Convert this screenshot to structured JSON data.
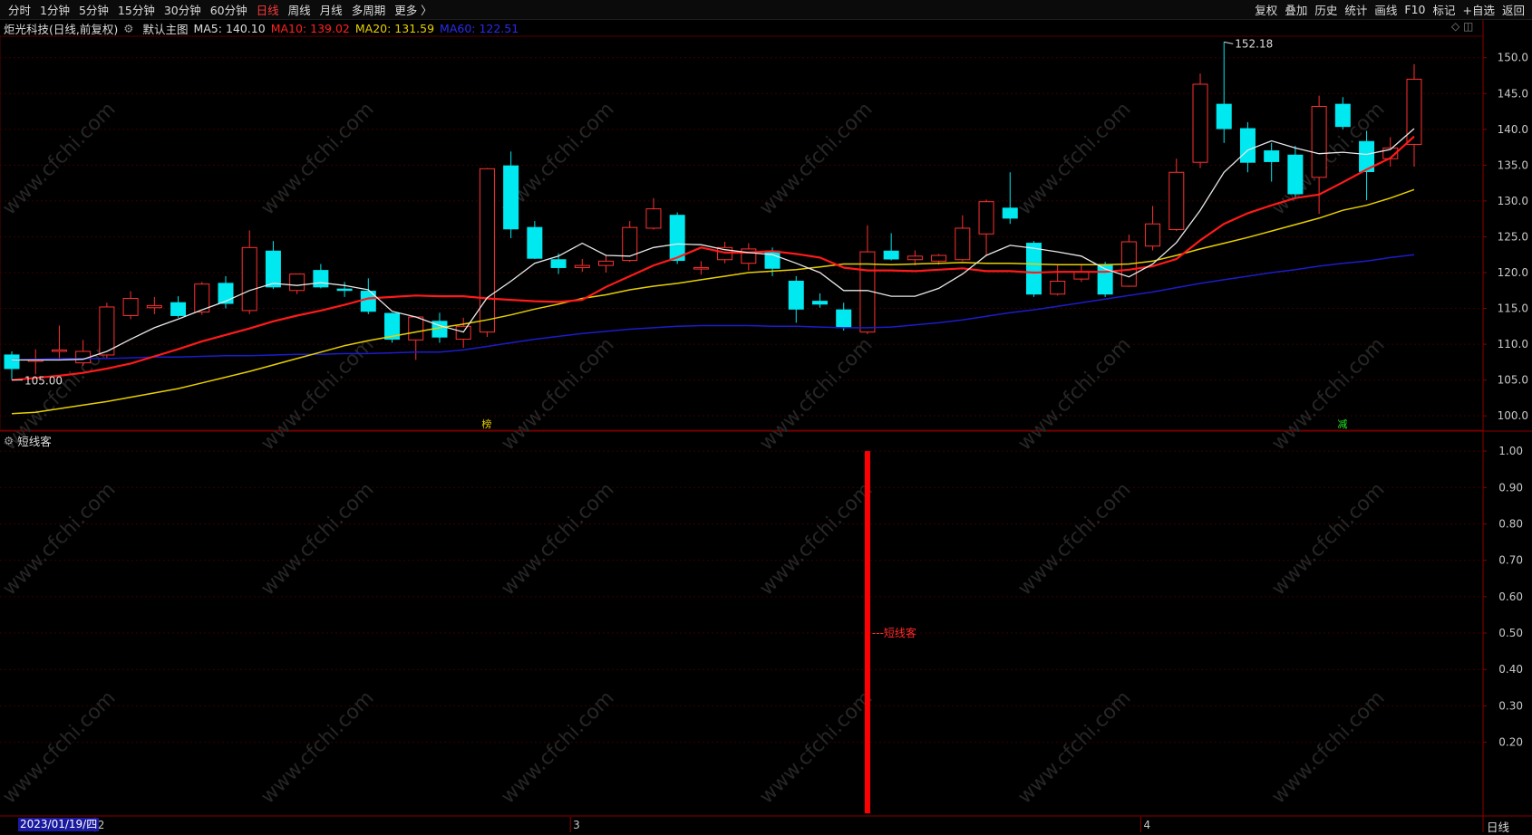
{
  "topbar": {
    "tabs": [
      "分时",
      "1分钟",
      "5分钟",
      "15分钟",
      "30分钟",
      "60分钟",
      "日线",
      "周线",
      "月线",
      "多周期",
      "更多 〉"
    ],
    "active_tab": "日线",
    "tools": [
      "复权",
      "叠加",
      "历史",
      "统计",
      "画线",
      "F10",
      "标记",
      "+自选",
      "返回"
    ]
  },
  "header": {
    "stock": "炬光科技(日线,前复权)",
    "main_chart": "默认主图",
    "ma5": "MA5: 140.10",
    "ma10": "MA10: 139.02",
    "ma20": "MA20: 131.59",
    "ma60": "MA60: 122.51"
  },
  "sub_panel": {
    "title": "短线客",
    "signal_label": "短线客"
  },
  "footer": {
    "date": "2023/01/19/四",
    "month_labels": [
      "2",
      "3",
      "4"
    ],
    "period": "日线"
  },
  "annotations": {
    "high": "152.18",
    "low": "105.00",
    "mark1": "榜",
    "mark2": "减"
  },
  "watermark": "www.cfchi.com",
  "chart_data": [
    {
      "type": "candlestick",
      "ylim": [
        98,
        153
      ],
      "y_ticks": [
        "150.0",
        "145.0",
        "140.0",
        "135.0",
        "130.0",
        "125.0",
        "120.0",
        "115.0",
        "110.0",
        "105.0",
        "100.0"
      ],
      "candles": [
        [
          108.5,
          106.6,
          109.0,
          105.0
        ],
        [
          107.6,
          107.8,
          109.3,
          105.8
        ],
        [
          109.0,
          109.2,
          112.6,
          107.8
        ],
        [
          107.4,
          109.0,
          110.6,
          107.0
        ],
        [
          108.5,
          115.2,
          115.8,
          108.0
        ],
        [
          114.0,
          116.4,
          117.4,
          113.5
        ],
        [
          115.1,
          115.4,
          116.6,
          114.2
        ],
        [
          115.8,
          114.0,
          116.7,
          113.7
        ],
        [
          114.5,
          118.4,
          118.7,
          114.1
        ],
        [
          118.5,
          115.7,
          119.5,
          115.0
        ],
        [
          114.7,
          123.5,
          125.9,
          114.2
        ],
        [
          123.0,
          118.0,
          124.4,
          117.7
        ],
        [
          117.5,
          119.8,
          119.6,
          117.0
        ],
        [
          120.3,
          118.0,
          121.2,
          117.8
        ],
        [
          117.7,
          117.6,
          118.7,
          116.6
        ],
        [
          117.4,
          114.6,
          119.2,
          114.2
        ],
        [
          114.3,
          110.7,
          114.4,
          110.2
        ],
        [
          110.6,
          113.8,
          113.9,
          107.8
        ],
        [
          113.2,
          111.0,
          114.4,
          110.2
        ],
        [
          110.7,
          112.5,
          113.7,
          109.5
        ],
        [
          111.7,
          134.5,
          134.6,
          111.0
        ],
        [
          134.9,
          126.1,
          136.9,
          124.8
        ],
        [
          126.3,
          122.0,
          127.2,
          121.9
        ],
        [
          121.8,
          120.7,
          122.7,
          119.8
        ],
        [
          120.7,
          121.0,
          121.9,
          120.1
        ],
        [
          121.0,
          121.6,
          122.5,
          120.0
        ],
        [
          121.7,
          126.3,
          127.2,
          121.5
        ],
        [
          126.2,
          128.9,
          130.4,
          126.0
        ],
        [
          128.0,
          121.7,
          128.4,
          121.2
        ],
        [
          120.5,
          120.7,
          121.6,
          119.7
        ],
        [
          121.8,
          123.5,
          124.3,
          121.3
        ],
        [
          121.3,
          123.3,
          124.1,
          120.3
        ],
        [
          123.0,
          120.6,
          123.5,
          119.5
        ],
        [
          118.8,
          114.9,
          119.5,
          113.0
        ],
        [
          116.0,
          115.6,
          117.1,
          115.1
        ],
        [
          114.8,
          112.3,
          115.8,
          111.9
        ],
        [
          111.7,
          122.9,
          126.6,
          111.4
        ],
        [
          123.0,
          121.9,
          125.5,
          121.7
        ],
        [
          121.8,
          122.3,
          123.1,
          121.0
        ],
        [
          121.6,
          122.4,
          122.6,
          121.1
        ],
        [
          121.8,
          126.2,
          128.0,
          121.6
        ],
        [
          125.4,
          129.9,
          130.2,
          122.3
        ],
        [
          129.0,
          127.6,
          134.0,
          126.8
        ],
        [
          124.1,
          117.0,
          124.4,
          116.6
        ],
        [
          117.0,
          118.8,
          121.0,
          116.8
        ],
        [
          119.1,
          120.1,
          121.2,
          118.7
        ],
        [
          121.1,
          117.0,
          121.5,
          116.6
        ],
        [
          118.1,
          124.3,
          125.3,
          118.0
        ],
        [
          123.7,
          126.8,
          129.3,
          123.1
        ],
        [
          126.0,
          134.0,
          135.9,
          125.8
        ],
        [
          135.4,
          146.3,
          147.8,
          134.6
        ],
        [
          143.5,
          140.1,
          152.2,
          138.1
        ],
        [
          140.1,
          135.4,
          141.0,
          134.0
        ],
        [
          137.0,
          135.5,
          138.1,
          132.7
        ],
        [
          136.4,
          131.0,
          137.7,
          130.3
        ],
        [
          133.3,
          143.2,
          144.7,
          128.2
        ],
        [
          143.5,
          140.4,
          144.5,
          140.0
        ],
        [
          138.3,
          134.1,
          139.8,
          130.1
        ],
        [
          135.9,
          137.4,
          138.9,
          134.8
        ],
        [
          137.9,
          147.0,
          149.1,
          134.8
        ]
      ],
      "ma5": [
        107.8,
        107.8,
        107.8,
        107.9,
        109.0,
        110.7,
        112.3,
        113.5,
        114.8,
        116.0,
        117.5,
        118.5,
        118.2,
        118.6,
        118.2,
        117.6,
        114.6,
        113.8,
        112.6,
        111.7,
        116.5,
        118.8,
        121.3,
        122.3,
        124.1,
        122.4,
        122.3,
        123.5,
        124.0,
        123.9,
        123.2,
        122.8,
        122.5,
        121.3,
        120.0,
        117.5,
        117.5,
        116.7,
        116.7,
        117.8,
        119.8,
        122.4,
        123.8,
        123.4,
        122.9,
        122.3,
        120.5,
        119.4,
        121.2,
        124.2,
        128.7,
        134.0,
        137.1,
        138.4,
        137.4,
        136.6,
        136.8,
        136.5,
        137.2,
        140.1
      ],
      "ma10": [
        105.0,
        105.3,
        105.6,
        106.0,
        106.6,
        107.3,
        108.3,
        109.3,
        110.4,
        111.3,
        112.2,
        113.2,
        114.0,
        114.7,
        115.5,
        116.4,
        116.6,
        116.8,
        116.7,
        116.7,
        116.4,
        116.2,
        116.0,
        115.9,
        116.2,
        118.0,
        119.5,
        121.0,
        122.1,
        123.5,
        122.8,
        122.8,
        123.0,
        122.6,
        122.1,
        120.7,
        120.3,
        120.3,
        120.2,
        120.4,
        120.6,
        120.2,
        120.2,
        120.0,
        120.1,
        120.1,
        120.1,
        120.4,
        120.9,
        121.9,
        124.5,
        126.8,
        128.3,
        129.4,
        130.4,
        130.9,
        132.6,
        134.4,
        136.0,
        139.0
      ],
      "ma20": [
        100.3,
        100.5,
        101.0,
        101.5,
        102.0,
        102.6,
        103.2,
        103.8,
        104.6,
        105.4,
        106.2,
        107.1,
        108.0,
        108.9,
        109.8,
        110.5,
        111.1,
        111.7,
        112.3,
        112.8,
        113.4,
        114.1,
        114.9,
        115.6,
        116.4,
        116.9,
        117.6,
        118.1,
        118.5,
        119.0,
        119.5,
        120.0,
        120.2,
        120.4,
        120.8,
        121.2,
        121.2,
        121.1,
        121.2,
        121.3,
        121.4,
        121.3,
        121.3,
        121.2,
        121.1,
        121.1,
        121.1,
        121.2,
        121.6,
        122.4,
        123.3,
        124.1,
        124.9,
        125.8,
        126.7,
        127.6,
        128.7,
        129.4,
        130.4,
        131.6
      ],
      "ma60": [
        107.8,
        107.9,
        108.0,
        108.0,
        108.0,
        108.1,
        108.2,
        108.2,
        108.3,
        108.4,
        108.4,
        108.5,
        108.6,
        108.6,
        108.7,
        108.7,
        108.8,
        108.9,
        108.9,
        109.2,
        109.7,
        110.2,
        110.7,
        111.1,
        111.5,
        111.8,
        112.1,
        112.3,
        112.5,
        112.6,
        112.6,
        112.6,
        112.5,
        112.5,
        112.4,
        112.3,
        112.3,
        112.4,
        112.7,
        113.0,
        113.4,
        113.9,
        114.4,
        114.8,
        115.3,
        115.8,
        116.3,
        116.8,
        117.3,
        117.9,
        118.5,
        119.0,
        119.5,
        120.0,
        120.4,
        120.9,
        121.3,
        121.6,
        122.1,
        122.5
      ]
    },
    {
      "type": "bar",
      "ylim": [
        0,
        1.05
      ],
      "y_ticks": [
        "1.00",
        "0.90",
        "0.80",
        "0.70",
        "0.60",
        "0.50",
        "0.40",
        "0.30",
        "0.20"
      ],
      "signal_index": 36,
      "signal_value": 1.0
    }
  ],
  "colors": {
    "up": "#ff3030",
    "down": "#00e8f0",
    "ma5": "#e8e8e8",
    "ma10": "#ff1a1a",
    "ma20": "#e8d000",
    "ma60": "#1c1ccc",
    "grid": "#3a0000",
    "signal": "#ff0000"
  }
}
